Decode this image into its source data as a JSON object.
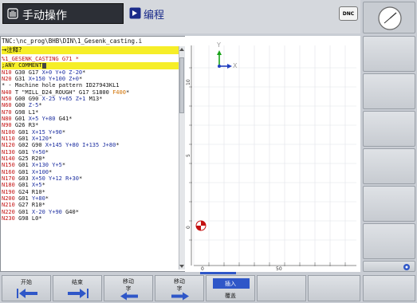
{
  "header": {
    "main_mode": "手动操作",
    "prog_mode": "编程",
    "dnc_label": "DNC"
  },
  "program": {
    "path": "TNC:\\nc_prog\\BHB\\DIN\\1_Gesenk_casting.i",
    "search_label": "→注释?",
    "lines": [
      {
        "segs": [
          {
            "t": "%1_GESENK_CASTING G71 *",
            "c": "r"
          }
        ]
      },
      {
        "hl": true,
        "segs": [
          {
            "t": ";ANY COMMENT",
            "c": "k"
          }
        ]
      },
      {
        "segs": [
          {
            "t": "N10 ",
            "c": "r"
          },
          {
            "t": "G30 G17 ",
            "c": "k"
          },
          {
            "t": "X+0 Y+0 Z-20",
            "c": "b"
          },
          {
            "t": "*",
            "c": "k"
          }
        ]
      },
      {
        "segs": [
          {
            "t": "N20 ",
            "c": "r"
          },
          {
            "t": "G31 ",
            "c": "k"
          },
          {
            "t": "X+150 Y+100 Z+0",
            "c": "b"
          },
          {
            "t": "*",
            "c": "k"
          }
        ]
      },
      {
        "segs": [
          {
            "t": "* - Machine hole pattern ID27943KL1",
            "c": "k"
          }
        ]
      },
      {
        "segs": [
          {
            "t": "N40 ",
            "c": "r"
          },
          {
            "t": "T \"MILL_D24_ROUGH\" G17 S1800 ",
            "c": "k"
          },
          {
            "t": "F400",
            "c": "o"
          },
          {
            "t": "*",
            "c": "k"
          }
        ]
      },
      {
        "segs": [
          {
            "t": "N50 ",
            "c": "r"
          },
          {
            "t": "G00 G90 ",
            "c": "k"
          },
          {
            "t": "X-25 Y+65 Z+1 ",
            "c": "b"
          },
          {
            "t": "M13*",
            "c": "k"
          }
        ]
      },
      {
        "segs": [
          {
            "t": "N60 ",
            "c": "r"
          },
          {
            "t": "G00 ",
            "c": "k"
          },
          {
            "t": "Z-5",
            "c": "b"
          },
          {
            "t": "*",
            "c": "k"
          }
        ]
      },
      {
        "segs": [
          {
            "t": "N70 ",
            "c": "r"
          },
          {
            "t": "G98 L1*",
            "c": "k"
          }
        ]
      },
      {
        "segs": [
          {
            "t": "N80 ",
            "c": "r"
          },
          {
            "t": "G01 ",
            "c": "k"
          },
          {
            "t": "X+5 Y+80 ",
            "c": "b"
          },
          {
            "t": "G41*",
            "c": "k"
          }
        ]
      },
      {
        "segs": [
          {
            "t": "N90 ",
            "c": "r"
          },
          {
            "t": "G26 R3*",
            "c": "k"
          }
        ]
      },
      {
        "segs": [
          {
            "t": "N100 ",
            "c": "r"
          },
          {
            "t": "G01 ",
            "c": "k"
          },
          {
            "t": "X+15 Y+90",
            "c": "b"
          },
          {
            "t": "*",
            "c": "k"
          }
        ]
      },
      {
        "segs": [
          {
            "t": "N110 ",
            "c": "r"
          },
          {
            "t": "G01 ",
            "c": "k"
          },
          {
            "t": "X+120",
            "c": "b"
          },
          {
            "t": "*",
            "c": "k"
          }
        ]
      },
      {
        "segs": [
          {
            "t": "N120 ",
            "c": "r"
          },
          {
            "t": "G02 G90 ",
            "c": "k"
          },
          {
            "t": "X+145 Y+80 I+135 J+80",
            "c": "b"
          },
          {
            "t": "*",
            "c": "k"
          }
        ]
      },
      {
        "segs": [
          {
            "t": "N130 ",
            "c": "r"
          },
          {
            "t": "G01 ",
            "c": "k"
          },
          {
            "t": "Y+50",
            "c": "b"
          },
          {
            "t": "*",
            "c": "k"
          }
        ]
      },
      {
        "segs": [
          {
            "t": "N140 ",
            "c": "r"
          },
          {
            "t": "G25 R20*",
            "c": "k"
          }
        ]
      },
      {
        "segs": [
          {
            "t": "N150 ",
            "c": "r"
          },
          {
            "t": "G01 ",
            "c": "k"
          },
          {
            "t": "X+130 Y+5",
            "c": "b"
          },
          {
            "t": "*",
            "c": "k"
          }
        ]
      },
      {
        "segs": [
          {
            "t": "N160 ",
            "c": "r"
          },
          {
            "t": "G01 ",
            "c": "k"
          },
          {
            "t": "X+100",
            "c": "b"
          },
          {
            "t": "*",
            "c": "k"
          }
        ]
      },
      {
        "segs": [
          {
            "t": "N170 ",
            "c": "r"
          },
          {
            "t": "G03 ",
            "c": "k"
          },
          {
            "t": "X+50 Y+12 R+30",
            "c": "b"
          },
          {
            "t": "*",
            "c": "k"
          }
        ]
      },
      {
        "segs": [
          {
            "t": "N180 ",
            "c": "r"
          },
          {
            "t": "G01 ",
            "c": "k"
          },
          {
            "t": "X+5",
            "c": "b"
          },
          {
            "t": "*",
            "c": "k"
          }
        ]
      },
      {
        "segs": [
          {
            "t": "N190 ",
            "c": "r"
          },
          {
            "t": "G24 R10*",
            "c": "k"
          }
        ]
      },
      {
        "segs": [
          {
            "t": "N200 ",
            "c": "r"
          },
          {
            "t": "G01 ",
            "c": "k"
          },
          {
            "t": "Y+80",
            "c": "b"
          },
          {
            "t": "*",
            "c": "k"
          }
        ]
      },
      {
        "segs": [
          {
            "t": "N210 ",
            "c": "r"
          },
          {
            "t": "G27 R10*",
            "c": "k"
          }
        ]
      },
      {
        "segs": [
          {
            "t": "N220 ",
            "c": "r"
          },
          {
            "t": "G01 ",
            "c": "k"
          },
          {
            "t": "X-20 Y+90 ",
            "c": "b"
          },
          {
            "t": "G40*",
            "c": "k"
          }
        ]
      },
      {
        "segs": [
          {
            "t": "N230 ",
            "c": "r"
          },
          {
            "t": "G98 L0*",
            "c": "k"
          }
        ]
      }
    ]
  },
  "graphics": {
    "axis_x": "X",
    "axis_y": "Y",
    "scale_left": [
      "10",
      "5",
      "0"
    ],
    "scale_bottom": [
      "0",
      "50"
    ]
  },
  "softkeys": [
    {
      "top": "开始",
      "bottom": "",
      "icon": "arrow-left-start-icon"
    },
    {
      "top": "结束",
      "bottom": "",
      "icon": "arrow-right-end-icon"
    },
    {
      "top": "移动",
      "bottom": "字",
      "icon": "arrow-left-icon"
    },
    {
      "top": "移动",
      "bottom": "字",
      "icon": "arrow-right-icon"
    },
    {
      "top": "插入",
      "bottom": "覆盖",
      "icon": ""
    }
  ]
}
